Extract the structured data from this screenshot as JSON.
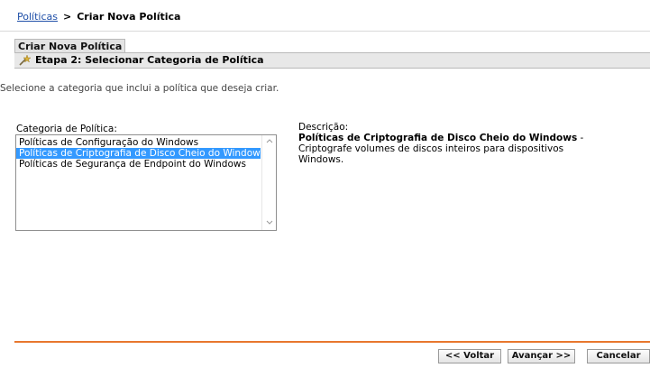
{
  "breadcrumb": {
    "link": "Políticas",
    "separator": ">",
    "current": "Criar Nova Política"
  },
  "tab": {
    "label": "Criar Nova Política"
  },
  "step": {
    "label": "Etapa 2: Selecionar Categoria de Política",
    "icon": "wizard-wand-icon"
  },
  "instructions": "Selecione a categoria que inclui a política que deseja criar.",
  "category": {
    "label": "Categoria de Política:",
    "options": [
      "Políticas de Configuração do Windows",
      "Políticas de Criptografia de Disco Cheio do Windows",
      "Políticas de Segurança de Endpoint do Windows"
    ],
    "selected": "Políticas de Criptografia de Disco Cheio do Windows"
  },
  "description": {
    "label": "Descrição:",
    "title": "Políticas de Criptografia de Disco Cheio do Windows",
    "dash": " -",
    "text": "Criptografe volumes de discos inteiros para dispositivos Windows."
  },
  "buttons": {
    "back": "<< Voltar",
    "next": "Avançar >>",
    "cancel": "Cancelar"
  },
  "colors": {
    "accent_rule": "#e8772e",
    "selection": "#3399ff",
    "link": "#1f4fa8"
  }
}
